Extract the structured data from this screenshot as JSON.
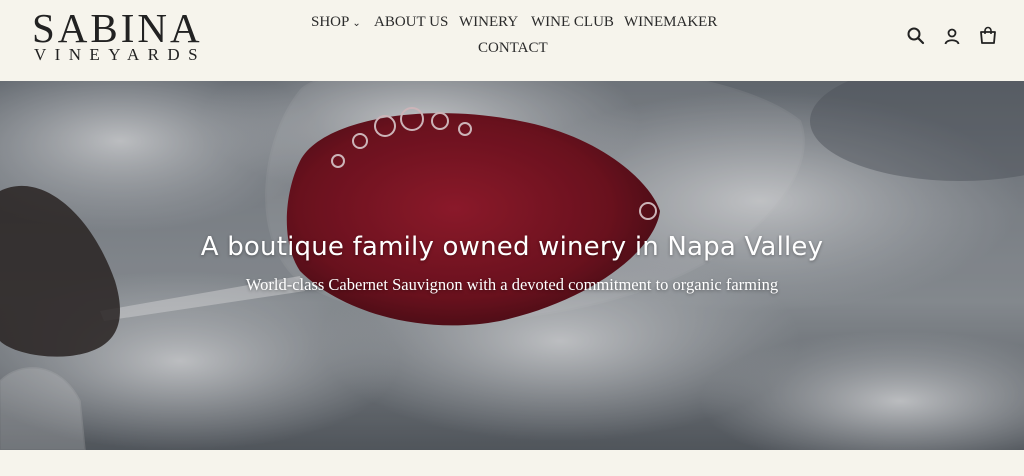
{
  "brand": {
    "name": "SABINA",
    "tagline": "VINEYARDS"
  },
  "nav": {
    "shop": "SHOP",
    "about": "ABOUT US",
    "winery": "WINERY",
    "wine_club": "WINE CLUB",
    "winemaker": "WINEMAKER",
    "contact": "CONTACT"
  },
  "header_icons": [
    "search-icon",
    "account-icon",
    "cart-icon"
  ],
  "hero": {
    "title": "A boutique family owned winery in Napa Valley",
    "subtitle": "World-class Cabernet Sauvignon with a devoted commitment to organic farming"
  },
  "colors": {
    "background": "#f6f4ec",
    "wine": "#7a0f1d",
    "text": "#2a2a2a"
  }
}
